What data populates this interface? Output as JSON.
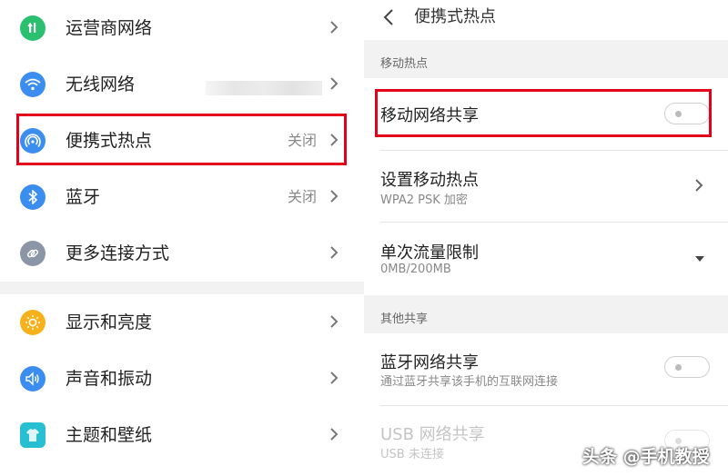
{
  "left_panel": {
    "items": [
      {
        "label": "运营商网络",
        "status": "",
        "icon": "signal-bars-icon",
        "color": "#2bc06f"
      },
      {
        "label": "无线网络",
        "status": "",
        "icon": "wifi-icon",
        "color": "#3b8ef0"
      },
      {
        "label": "便携式热点",
        "status": "关闭",
        "icon": "hotspot-icon",
        "color": "#3b8ef0"
      },
      {
        "label": "蓝牙",
        "status": "关闭",
        "icon": "bluetooth-icon",
        "color": "#3b8ef0"
      },
      {
        "label": "更多连接方式",
        "status": "",
        "icon": "link-icon",
        "color": "#8a95a5"
      },
      {
        "label": "显示和亮度",
        "status": "",
        "icon": "sun-icon",
        "color": "#f7b21b"
      },
      {
        "label": "声音和振动",
        "status": "",
        "icon": "speaker-icon",
        "color": "#3b8ef0"
      },
      {
        "label": "主题和壁纸",
        "status": "",
        "icon": "shirt-icon",
        "color": "#27bfd1"
      }
    ]
  },
  "right_panel": {
    "title": "便携式热点",
    "sections": {
      "hotspot": "移动热点",
      "other": "其他共享"
    },
    "mobile_share": {
      "label": "移动网络共享",
      "enabled": false
    },
    "setup_hotspot": {
      "label": "设置移动热点",
      "sub": "WPA2 PSK 加密"
    },
    "data_limit": {
      "label": "单次流量限制",
      "sub": "0MB/200MB"
    },
    "bt_share": {
      "label": "蓝牙网络共享",
      "sub": "通过蓝牙共享该手机的互联网连接",
      "enabled": false
    },
    "usb_share": {
      "label": "USB 网络共享",
      "sub": "USB 未连接",
      "enabled": false
    }
  },
  "watermark": "头条 @手机教授",
  "colors": {
    "highlight": "#e3001b",
    "accent_blue": "#3b8ef0"
  }
}
